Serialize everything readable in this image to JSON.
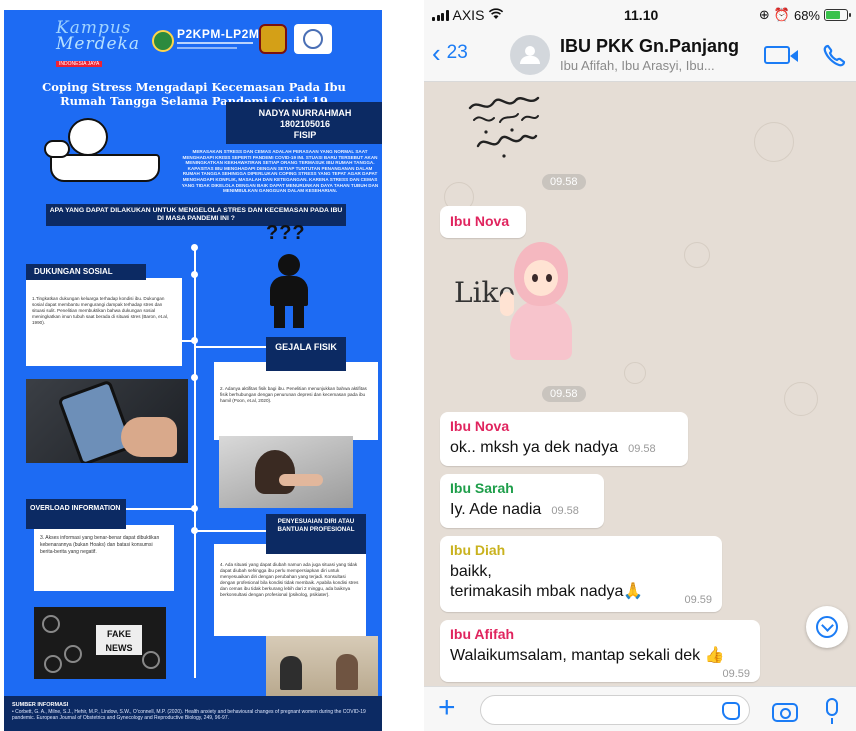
{
  "poster": {
    "logo": {
      "line1": "Kampus",
      "line2": "Merdeka",
      "tagline": "INDONESIA JAYA"
    },
    "p2kpm": "P2KPM-LP2M",
    "title": "Coping Stress  Mengadapi Kecemasan Pada Ibu Rumah Tangga  Selama Pandemi Covid 19",
    "author_name": "NADYA NURRAHMAH",
    "author_id": "1802105016",
    "author_faculty": "FISIP",
    "intro": "MERASAKAN STRESS DAN CEMAS ADALAH PERASAAN YANG NORMAL SAAT MENGHADAPI KRISIS SEPERTI PANDEMI COVID-19 INI. STUASI BARU TERSEBUT AKAN MENINGKATKAN KEKHAWATIRAN SETIAP ORANG TERMASUK IBU RUMAH TANGGA. KAPASITAS IBU MENGHADAPI DENGAN SETIAP TUNTUTAN PENANGANAN DALAM RUMAH TANGGA SEHINGGA DIPERLUKAN COPING STRESS YANG TEPAT AGAR DAPAT MENGHADAPI KONFLIK, MASALAH DAN KETEGANGAN. KARENA STRESS DAN CEMAS YANG TIDAK DIKELOLA DENGAN BAIK DAPAT MENURUNKAN DAYA TAHAN TUBUH DAN MENIMBULKAN GANGGUAN DALAM KESEHARIAN.",
    "question": "APA YANG DAPAT DILAKUKAN UNTUK MENGELOLA STRES DAN KECEMASAN PADA IBU DI MASA PANDEMI INI ?",
    "qmarks": "???",
    "sections": {
      "social": {
        "label": "DUKUNGAN SOSIAL",
        "text": "1.Tingkatkan dukungan keluarga terhadap kondisi ibu. Dukungan sosial dapat membantu mengurangi dampak terhadap stres dan situasi sulit. Penelitian membuktikan bahwa dukungan sosial meningkatkan imun tubuh saat berada di situasi stres (Baron, et.al, 1990)."
      },
      "physical": {
        "label": "GEJALA FISIK",
        "text": "2. Adanya aktifitas fisik bagi ibu. Penelitian menunjukkan bahwa aktifitas fisik berhubungan dengan penurunan depresi dan kecemasan pada ibu hamil (Poon, et.al, 2020)."
      },
      "overload": {
        "label": "OVERLOAD INFORMATION",
        "text": "3. Akses informasi yang benar-benar dapat dibuktikan kebenarannya (bukan Hoaks) dan batasi konsumsi berita-berita yang negatif."
      },
      "professional": {
        "label": "PENYESUAIAN DIRI ATAU BANTUAN PROFESIONAL",
        "text": "4. Ada situasi yang dapat diubah namun ada juga situasi yang tidak dapat diubah sehingga ibu perlu mempersiapkan diri untuk menyesuaikan diri dengan perubahan yang terjadi. Konsultasi dengan profesional bila kondisi tidak membaik. Apabila kondisi stres dan cemas ibu tidak berkurang lebih dari 2 minggu, ada baiknya berkonsultasi dengan profesional (psikolog, psikiater)."
      }
    },
    "fake_news": "FAKE NEWS",
    "source_title": "SUMBER INFORMASI",
    "source_text": "•  Corbett, G. A., Milne, S.J., Hehir, M.P., Lindow, S.W., O'connell, M.P. (2020). Health anxiety and behavioural changes of pregnant women during the COVID-19 pandemic. European Journal of Obstetrics and Gynecology and Reproductive Biology, 249, 96-97."
  },
  "status_bar": {
    "carrier": "AXIS",
    "time": "11.10",
    "battery": "68%",
    "battery_level": 0.68
  },
  "header": {
    "back_count": "23",
    "group_name": "IBU PKK Gn.Panjang",
    "members": "Ibu Afifah, Ibu Arasyi, Ibu..."
  },
  "messages": [
    {
      "type": "sticker",
      "time": "09.58"
    },
    {
      "type": "sticker",
      "sender": "Ibu Nova",
      "sender_color": "#e0245e",
      "sticker_text": "Like",
      "time": "09.58"
    },
    {
      "type": "text",
      "sender": "Ibu Nova",
      "sender_color": "#e0245e",
      "text": "ok.. mksh ya dek nadya",
      "time": "09.58"
    },
    {
      "type": "text",
      "sender": "Ibu Sarah",
      "sender_color": "#1e9e4a",
      "text": "Iy. Ade nadia",
      "time": "09.58"
    },
    {
      "type": "text",
      "sender": "Ibu Diah",
      "sender_color": "#c9b21e",
      "text_line1": "baikk,",
      "text_line2": "terimakasih mbak nadya🙏",
      "time": "09.59"
    },
    {
      "type": "text",
      "sender": "Ibu Afifah",
      "sender_color": "#e0245e",
      "text": "Walaikumsalam, mantap sekali dek 👍",
      "time": "09.59"
    }
  ],
  "colors": {
    "poster_bg": "#1d6bf3",
    "poster_dark": "#0c2a63",
    "ios_blue": "#1b7cf5",
    "chat_bg": "#e5ddd5"
  }
}
